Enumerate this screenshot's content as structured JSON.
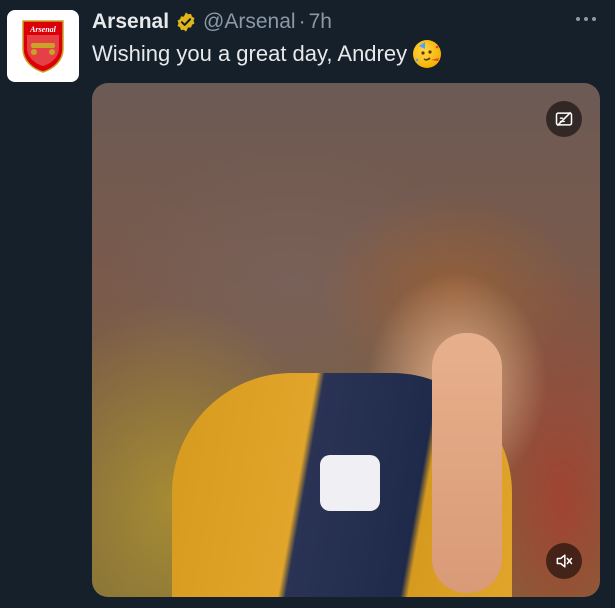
{
  "tweet": {
    "author": {
      "display_name": "Arsenal",
      "handle": "@Arsenal",
      "separator": "·",
      "time": "7h",
      "verified": true,
      "avatar_icon": "arsenal-crest-icon",
      "avatar_text": "Arsenal"
    },
    "text": "Wishing you a great day, Andrey",
    "emoji_icon": "partying-face-icon",
    "media": {
      "type": "video",
      "controls": {
        "top_right_icon": "captions-off-icon",
        "bottom_right_icon": "volume-muted-icon"
      }
    },
    "more_icon": "more-horizontal-icon"
  },
  "colors": {
    "background": "#15202b",
    "text_primary": "#e7e9ea",
    "text_secondary": "#8b98a5",
    "verified_gold": "#e2b719",
    "crest_red": "#db0007"
  }
}
